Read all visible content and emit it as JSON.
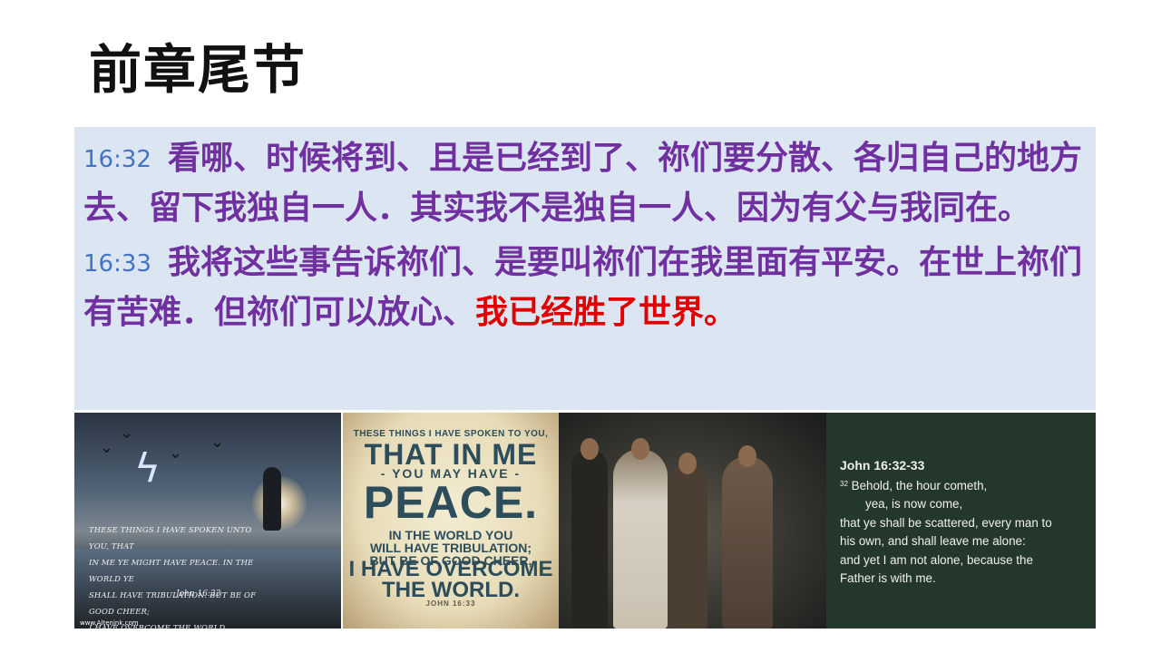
{
  "title": "前章尾节",
  "verses": [
    {
      "ref": "16:32",
      "text": "看哪、时候将到、且是已经到了、祢们要分散、各归自己的地方去、留下我独自一人．其实我不是独自一人、因为有父与我同在。",
      "highlight": ""
    },
    {
      "ref": "16:33",
      "text": "我将这些事告诉祢们、是要叫祢们在我里面有平安。在世上祢们有苦难．但祢们可以放心、",
      "highlight": "我已经胜了世界。"
    }
  ],
  "colors": {
    "verse_text": "#7030a0",
    "verse_ref": "#4472c4",
    "highlight": "#e00000",
    "box_bg": "#dce6f2"
  },
  "images": {
    "storm": {
      "caption_lines": [
        "These things I have spoken unto you, that",
        "in me ye might have peace. In the world ye",
        "shall have tribulation: but be of good cheer;",
        "I have overcome the world."
      ],
      "citation": "John 16:33",
      "watermark": "www.Altenink.com"
    },
    "poster": {
      "line1": "THESE THINGS I HAVE SPOKEN TO YOU,",
      "line2": "THAT IN ME",
      "line3": "- YOU MAY HAVE -",
      "line4": "PEACE.",
      "line5a": "IN THE WORLD YOU",
      "line5b": "WILL HAVE TRIBULATION;",
      "line5c": "BUT BE OF GOOD CHEER,",
      "line6a": "I HAVE OVERCOME",
      "line6b": "THE WORLD.",
      "citation": "JOHN 16:33"
    },
    "kjv": {
      "ref": "John 16:32-33",
      "verse_num": "32",
      "lines": [
        "Behold, the hour cometh,",
        "yea, is now come,",
        "that ye shall be scattered, every man to",
        "his own, and shall leave me alone:",
        "and yet I am not alone, because the",
        "Father is with me."
      ]
    }
  }
}
